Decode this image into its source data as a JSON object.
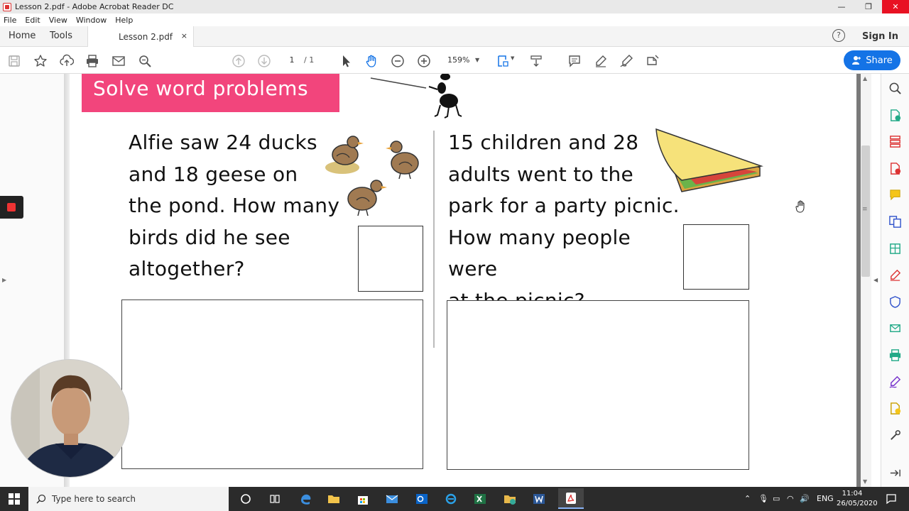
{
  "window": {
    "title": "Lesson 2.pdf - Adobe Acrobat Reader DC",
    "controls": {
      "minimize": "—",
      "maximize": "❐",
      "close": "✕"
    }
  },
  "menubar": {
    "items": [
      "File",
      "Edit",
      "View",
      "Window",
      "Help"
    ]
  },
  "tabs": {
    "home": "Home",
    "tools": "Tools",
    "document": "Lesson 2.pdf",
    "close": "×",
    "help": "?",
    "signin": "Sign In"
  },
  "toolbar": {
    "page_current": "1",
    "page_total": "/ 1",
    "zoom": "159%",
    "share_label": "Share",
    "icons": [
      "save-icon",
      "bookmark-star-icon",
      "upload-cloud-icon",
      "print-icon",
      "email-icon",
      "find-icon",
      "previous-page-icon",
      "next-page-icon",
      "select-pointer-icon",
      "hand-tool-icon",
      "zoom-out-icon",
      "zoom-in-icon",
      "fit-page-icon",
      "scroll-mode-icon",
      "comment-icon",
      "highlight-pen-icon",
      "sign-icon",
      "fill-sign-icon"
    ]
  },
  "document": {
    "heading": "Solve word problems",
    "problem1": [
      "Alfie saw 24 ducks",
      "and 18 geese on",
      "the pond. How many",
      "birds did he see",
      "altogether?"
    ],
    "problem2": [
      "15 children and 28",
      "adults went to the",
      "park for a party picnic.",
      "How many people were",
      "at the picnic?"
    ]
  },
  "right_panel": {
    "icons": [
      "search-zoom-icon",
      "export-pdf-icon",
      "organize-pages-icon",
      "create-pdf-icon",
      "comment-icon",
      "combine-files-icon",
      "edit-pdf-icon",
      "fill-sign-icon",
      "protect-icon",
      "send-review-icon",
      "print-production-icon",
      "sign-icon",
      "send-for-signature-icon",
      "more-tools-icon",
      "expand-panel-icon"
    ]
  },
  "taskbar": {
    "search_placeholder": "Type here to search",
    "language": "ENG",
    "time": "11:04",
    "date": "26/05/2020",
    "apps": [
      "cortana-icon",
      "task-view-icon",
      "edge-icon",
      "file-explorer-icon",
      "store-icon",
      "mail-icon",
      "outlook-icon",
      "ie-icon",
      "excel-icon",
      "folder-icon",
      "word-icon",
      "acrobat-icon"
    ]
  },
  "colors": {
    "heading_bg": "#f2457c",
    "share_button": "#1473e6",
    "close_button": "#e81123",
    "taskbar": "#2b2b2b"
  }
}
